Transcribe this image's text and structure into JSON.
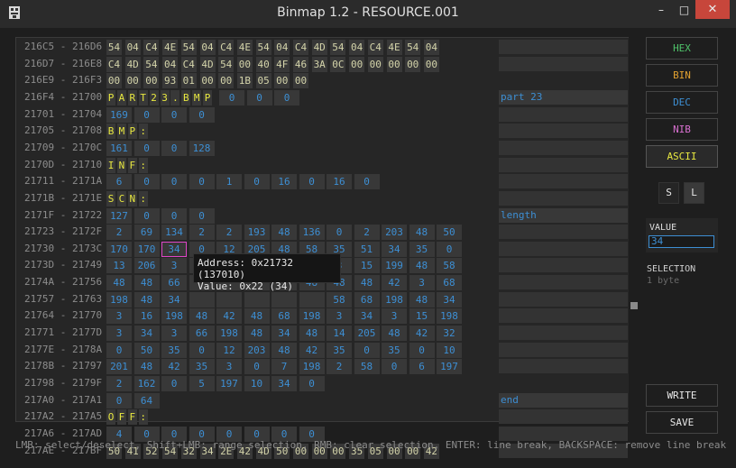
{
  "window": {
    "title": "Binmap 1.2 - RESOURCE.001",
    "minimize_glyph": "–",
    "maximize_glyph": "□",
    "close_glyph": "✕",
    "app_icon": "binmap-icon"
  },
  "rows": [
    {
      "addr": "216C5 - 216D6",
      "type": "hex",
      "cells": [
        "54",
        "04",
        "C4",
        "4E",
        "54",
        "04",
        "C4",
        "4E",
        "54",
        "04",
        "C4",
        "4D",
        "54",
        "04",
        "C4",
        "4E",
        "54",
        "04"
      ],
      "note": ""
    },
    {
      "addr": "216D7 - 216E8",
      "type": "hex",
      "cells": [
        "C4",
        "4D",
        "54",
        "04",
        "C4",
        "4D",
        "54",
        "00",
        "40",
        "4F",
        "46",
        "3A",
        "0C",
        "00",
        "00",
        "00",
        "00",
        "00"
      ],
      "note": ""
    },
    {
      "addr": "216E9 - 216F3",
      "type": "hex",
      "cells": [
        "00",
        "00",
        "00",
        "93",
        "01",
        "00",
        "00",
        "1B",
        "05",
        "00",
        "00"
      ],
      "note": null
    },
    {
      "addr": "216F4 - 21700",
      "type": "ascii",
      "cells": [
        "P",
        "A",
        "R",
        "T",
        "2",
        "3",
        ".",
        "B",
        "M",
        "P"
      ],
      "tail": [
        "0",
        "0",
        "0"
      ],
      "note": "part 23"
    },
    {
      "addr": "21701 - 21704",
      "type": "dec",
      "cells": [
        "169",
        "0",
        "0",
        "0"
      ],
      "note": ""
    },
    {
      "addr": "21705 - 21708",
      "type": "ascii",
      "cells": [
        "B",
        "M",
        "P",
        ":"
      ],
      "note": ""
    },
    {
      "addr": "21709 - 2170C",
      "type": "dec",
      "cells": [
        "161",
        "0",
        "0",
        "128"
      ],
      "note": ""
    },
    {
      "addr": "2170D - 21710",
      "type": "ascii",
      "cells": [
        "I",
        "N",
        "F",
        ":"
      ],
      "note": ""
    },
    {
      "addr": "21711 - 2171A",
      "type": "dec",
      "cells": [
        "6",
        "0",
        "0",
        "0",
        "1",
        "0",
        "16",
        "0",
        "16",
        "0"
      ],
      "note": ""
    },
    {
      "addr": "2171B - 2171E",
      "type": "ascii",
      "cells": [
        "S",
        "C",
        "N",
        ":"
      ],
      "note": ""
    },
    {
      "addr": "2171F - 21722",
      "type": "dec",
      "cells": [
        "127",
        "0",
        "0",
        "0"
      ],
      "note": "length"
    },
    {
      "addr": "21723 - 2172F",
      "type": "dec",
      "cells": [
        "2",
        "69",
        "134",
        "2",
        "2",
        "193",
        "48",
        "136",
        "0",
        "2",
        "203",
        "48",
        "50"
      ],
      "note": ""
    },
    {
      "addr": "21730 - 2173C",
      "type": "dec",
      "cells": [
        "170",
        "170",
        "34",
        "0",
        "12",
        "205",
        "48",
        "58",
        "35",
        "51",
        "34",
        "35",
        "0"
      ],
      "selected": 2,
      "note": ""
    },
    {
      "addr": "2173D - 21749",
      "type": "dec",
      "cells": [
        "13",
        "206",
        "3",
        "162",
        "48",
        "0",
        "3",
        "34",
        "3",
        "15",
        "199",
        "48",
        "58"
      ],
      "note": ""
    },
    {
      "addr": "2174A - 21756",
      "type": "dec",
      "cells": [
        "48",
        "48",
        "66",
        "",
        "",
        "",
        "",
        "48",
        "48",
        "48",
        "42",
        "3",
        "68"
      ],
      "note": ""
    },
    {
      "addr": "21757 - 21763",
      "type": "dec",
      "cells": [
        "198",
        "48",
        "34",
        "",
        "",
        "",
        "",
        "",
        "58",
        "68",
        "198",
        "48",
        "34"
      ],
      "note": ""
    },
    {
      "addr": "21764 - 21770",
      "type": "dec",
      "cells": [
        "3",
        "16",
        "198",
        "48",
        "42",
        "48",
        "68",
        "198",
        "3",
        "34",
        "3",
        "15",
        "198"
      ],
      "note": ""
    },
    {
      "addr": "21771 - 2177D",
      "type": "dec",
      "cells": [
        "3",
        "34",
        "3",
        "66",
        "198",
        "48",
        "34",
        "48",
        "14",
        "205",
        "48",
        "42",
        "32"
      ],
      "note": ""
    },
    {
      "addr": "2177E - 2178A",
      "type": "dec",
      "cells": [
        "0",
        "50",
        "35",
        "0",
        "12",
        "203",
        "48",
        "42",
        "35",
        "0",
        "35",
        "0",
        "10"
      ],
      "note": ""
    },
    {
      "addr": "2178B - 21797",
      "type": "dec",
      "cells": [
        "201",
        "48",
        "42",
        "35",
        "3",
        "0",
        "7",
        "198",
        "2",
        "58",
        "0",
        "6",
        "197"
      ],
      "note": ""
    },
    {
      "addr": "21798 - 2179F",
      "type": "dec",
      "cells": [
        "2",
        "162",
        "0",
        "5",
        "197",
        "10",
        "34",
        "0"
      ],
      "note": null
    },
    {
      "addr": "217A0 - 217A1",
      "type": "dec",
      "cells": [
        "0",
        "64"
      ],
      "note": "end"
    },
    {
      "addr": "217A2 - 217A5",
      "type": "ascii",
      "cells": [
        "O",
        "F",
        "F",
        ":"
      ],
      "note": ""
    },
    {
      "addr": "217A6 - 217AD",
      "type": "dec",
      "cells": [
        "4",
        "0",
        "0",
        "0",
        "0",
        "0",
        "0",
        "0"
      ],
      "note": ""
    },
    {
      "addr": "217AE - 217BF",
      "type": "hex",
      "cells": [
        "50",
        "41",
        "52",
        "54",
        "32",
        "34",
        "2E",
        "42",
        "4D",
        "50",
        "00",
        "00",
        "00",
        "35",
        "05",
        "00",
        "00",
        "42"
      ],
      "note": ""
    }
  ],
  "tooltip": {
    "line1": "Address: 0x21732 (137010)",
    "line2": "Value: 0x22 (34)"
  },
  "sidebar": {
    "hex_label": "HEX",
    "bin_label": "BIN",
    "dec_label": "DEC",
    "nib_label": "NIB",
    "ascii_label": "ASCII",
    "s_label": "S",
    "l_label": "L",
    "value_label": "VALUE",
    "value_input": "34",
    "selection_label": "SELECTION",
    "selection_value": "1 byte",
    "write_label": "WRITE",
    "save_label": "SAVE"
  },
  "status": "LMB: select/deselect, Shift+LMB: range selection, RMB: clear selection, ENTER: line break, BACKSPACE: remove line break",
  "colors": {
    "hex": "#4fc36a",
    "bin": "#e0a030",
    "dec": "#3d8fd4",
    "nib": "#d870d0",
    "ascii": "#e8e840",
    "close": "#c7463b",
    "selection_outline": "#e046c8"
  }
}
